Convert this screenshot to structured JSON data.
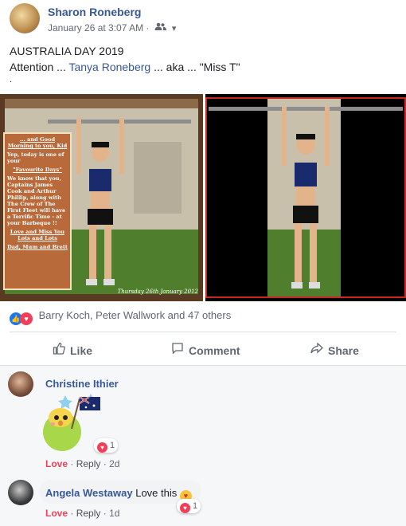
{
  "post": {
    "author": "Sharon Roneberg",
    "timestamp": "January 26 at 3:07 AM",
    "separator": "·",
    "audience_icon": "friends-icon",
    "text_line1": "AUSTRALIA DAY 2019",
    "text_line2_prefix": "Attention ... ",
    "mention": "Tanya Roneberg",
    "text_line2_suffix": " ... aka ... \"Miss T\"",
    "text_line3": "."
  },
  "photo1_note": {
    "p1": "... and Good Morning to you, Kid",
    "p2": "Yep, today is one of your",
    "p3": "\"Favourite Days\"",
    "p4": "We know that you, Captains James Cook and Arthur Phillip, along with The Crew of The First Fleet will have a Terrific Time - at your Barbeque !!",
    "p5": "Love and Miss You Lots and Lots",
    "p6": "Dad, Mum and Brett",
    "date": "Thursday 26th January 2012"
  },
  "reactions": {
    "summary": "Barry Koch, Peter Wallwork and 47 others",
    "like_icon": "like-icon",
    "love_icon": "love-icon"
  },
  "actions": {
    "like": "Like",
    "comment": "Comment",
    "share": "Share"
  },
  "comments": [
    {
      "name": "Christine Ithier",
      "text": "",
      "reaction_count": "1",
      "love": "Love",
      "reply": "Reply",
      "time": "2d",
      "sep": "·"
    },
    {
      "name": "Angela Westaway",
      "text": "Love this",
      "reaction_count": "1",
      "love": "Love",
      "reply": "Reply",
      "time": "1d",
      "sep": "·"
    }
  ],
  "colors": {
    "link": "#365899",
    "love": "#f33e58",
    "like": "#1877f2"
  }
}
